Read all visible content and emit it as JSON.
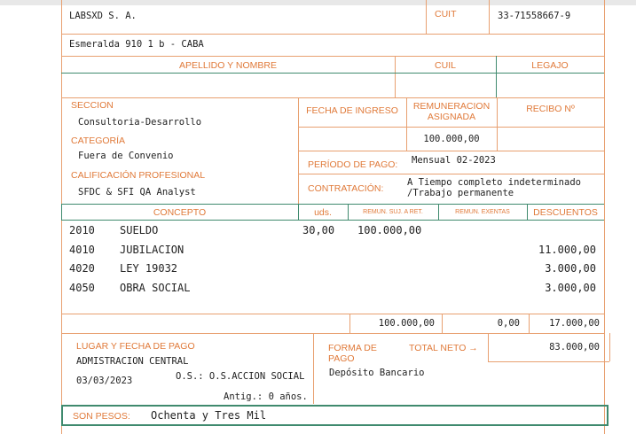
{
  "company": {
    "name": "LABSXD S. A.",
    "cuit_label": "CUIT",
    "cuit_value": "33-71558667-9",
    "address": "Esmeralda 910 1 b - CABA"
  },
  "employee_header": {
    "name_label": "APELLIDO Y NOMBRE",
    "cuil_label": "CUIL",
    "legajo_label": "LEGAJO"
  },
  "details": {
    "seccion_label": "SECCION",
    "seccion_value": "Consultoria-Desarrollo",
    "categoria_label": "CATEGORÍA",
    "categoria_value": "Fuera de Convenio",
    "calificacion_label": "CALIFICACIÓN PROFESIONAL",
    "calificacion_value": "SFDC & SFI QA Analyst",
    "fecha_ingreso_label": "FECHA DE INGRESO",
    "remuneracion_label_1": "REMUNERACION",
    "remuneracion_label_2": "ASIGNADA",
    "remuneracion_value": "100.000,00",
    "recibo_label": "RECIBO Nº",
    "periodo_label": "PERÍODO DE PAGO:",
    "periodo_value": "Mensual 02-2023",
    "contratacion_label": "CONTRATACIÓN:",
    "contratacion_value_1": "A Tiempo completo indeterminado",
    "contratacion_value_2": "/Trabajo permanente"
  },
  "table": {
    "headers": {
      "concepto": "CONCEPTO",
      "uds": "uds.",
      "remun_suj": "REMUN. SUJ. A RET.",
      "remun_exentas": "REMUN. EXENTAS",
      "descuentos": "DESCUENTOS"
    },
    "rows": [
      {
        "code": "2010",
        "concept": "SUELDO",
        "uds": "30,00",
        "remun": "100.000,00",
        "descuento": ""
      },
      {
        "code": "4010",
        "concept": "JUBILACION",
        "uds": "",
        "remun": "",
        "descuento": "11.000,00"
      },
      {
        "code": "4020",
        "concept": "LEY 19032",
        "uds": "",
        "remun": "",
        "descuento": "3.000,00"
      },
      {
        "code": "4050",
        "concept": "OBRA SOCIAL",
        "uds": "",
        "remun": "",
        "descuento": "3.000,00"
      }
    ],
    "totals": {
      "remun": "100.000,00",
      "exentas": "0,00",
      "descuentos": "17.000,00"
    }
  },
  "footer": {
    "lugar_label": "LUGAR Y FECHA DE PAGO",
    "lugar_value": "ADMISTRACION CENTRAL",
    "fecha_value": "03/03/2023",
    "os_value": "O.S.: O.S.ACCION SOCIAL",
    "antig_value": "Antig.: 0 años.",
    "forma_label_1": "FORMA DE",
    "forma_label_2": "PAGO",
    "forma_value": "Depósito Bancario",
    "total_neto_label": "TOTAL NETO →",
    "total_neto_value": "83.000,00",
    "son_pesos_label": "SON PESOS:",
    "son_pesos_value": "Ochenta y Tres Mil"
  },
  "colors": {
    "label_orange": "#e07a3a",
    "line_orange": "#e8a070",
    "line_green": "#3f8a6e"
  }
}
